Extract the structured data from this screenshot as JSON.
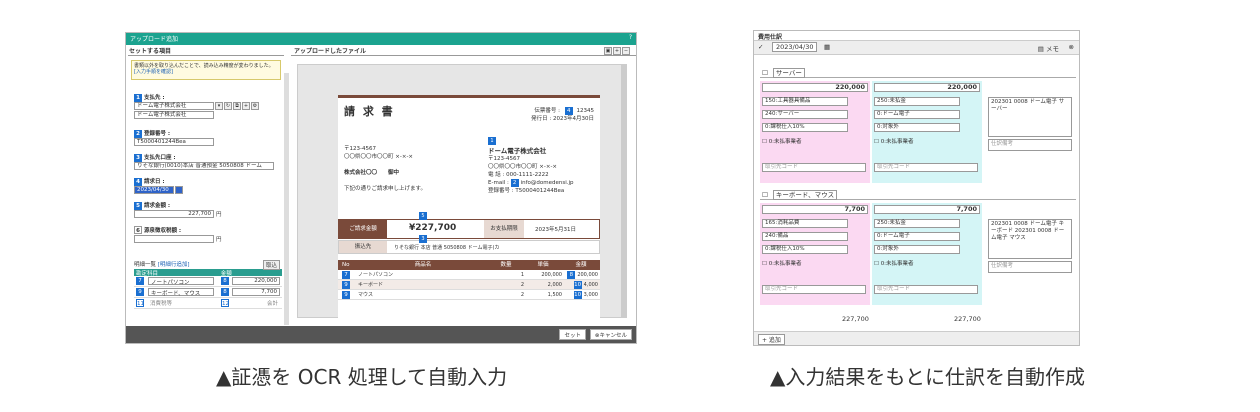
{
  "left": {
    "title": "アップロード追加",
    "left_panel": {
      "section_title": "セットする項目",
      "notice_text": "書類以外を取り込んだことで、読み込み精度が変わりました。",
      "notice_link": "[入力手順を確認]",
      "fields": [
        {
          "num": "1",
          "label": "支払先 :",
          "value": "ドーム電子株式会社",
          "sub": "ドーム電子株式会社"
        },
        {
          "num": "2",
          "label": "登録番号 :",
          "value": "T5000401244Bea"
        },
        {
          "num": "3",
          "label": "支払先口座 :",
          "value": "りそな銀行(0010)本店 普通預金 5050808 ドーム"
        },
        {
          "num": "4",
          "label": "請求日 :",
          "value": "2023/04/30"
        },
        {
          "num": "5",
          "label": "請求金額 :",
          "value": "227,700",
          "unit": "円"
        },
        {
          "num": "6",
          "label": "源泉徴収税額 :",
          "value": "",
          "unit": "円"
        }
      ],
      "detail_label": "明細一覧",
      "detail_link": "[明細行追加]",
      "detail_button": "取込",
      "grid_headers": [
        "勘定科目",
        "金額"
      ],
      "grid_rows": [
        {
          "n1": "7",
          "name": "ノートパソコン",
          "n2": "8",
          "amount": "220,000"
        },
        {
          "n1": "9",
          "name": "キーボード、マウス",
          "n2": "8",
          "amount": "7,700"
        },
        {
          "n1": "11",
          "name": "消費税等",
          "n2": "12",
          "amount": "会計"
        }
      ]
    },
    "right_panel": {
      "section_title": "アップロードしたファイル",
      "invoice": {
        "title": "請 求 書",
        "invoice_no_label": "伝票番号 :",
        "invoice_no": "12345",
        "issue_label": "発行日 :",
        "issue_date": "2023年4月30日",
        "zip": "〒123-4567",
        "address": "〇〇県〇〇市〇〇町 ×-×-×",
        "company_to": "株式会社〇〇",
        "honorific": "御中",
        "greeting": "下記の通りご請求申し上げます。",
        "issuer": "ドーム電子株式会社",
        "issuer_zip": "〒123-4567",
        "issuer_addr": "〇〇県〇〇市〇〇町 ×-×-×",
        "issuer_tel": "000-1111-2222",
        "issuer_mail": "info@domedensi.jp",
        "issuer_reg": "T5000401244Bea",
        "amount_label": "ご請求金額",
        "amount": "¥227,700",
        "due_label": "お支払期限",
        "due_date": "2023年5月31日",
        "bank_label": "振込先",
        "bank_value": "りそな銀行 本店 普通 5050808 ドーム電子(カ",
        "table_headers": [
          "No",
          "商品名",
          "数量",
          "単価",
          "金額"
        ],
        "table_rows": [
          {
            "name": "ノートパソコン",
            "qty": "1",
            "price": "200,000",
            "total": "200,000"
          },
          {
            "name": "キーボード",
            "qty": "2",
            "price": "2,000",
            "total": "4,000"
          },
          {
            "name": "マウス",
            "qty": "2",
            "price": "1,500",
            "total": "3,000"
          }
        ]
      }
    },
    "buttons": {
      "set": "セット",
      "cancel": "キャンセル"
    }
  },
  "right": {
    "title": "費用仕訳",
    "date": "2023/04/30",
    "memo_btn": "メモ",
    "groups": [
      {
        "title": "サーバー",
        "debit_amount": "220,000",
        "credit_amount": "220,000",
        "debit_rows": [
          "150:工具器具備品",
          "240:サーバー",
          "0:課税仕入10%"
        ],
        "credit_rows": [
          "250:未払金",
          "0:ドーム電子",
          "0:対象外"
        ],
        "memo": "202301 0008 ドーム電子 サーバー",
        "sub_memo": "仕訳備考",
        "check1": "0:未払事業者",
        "check2": "0:未払事業者",
        "code1": "取引先コード",
        "code2": "取引先コード"
      },
      {
        "title": "キーボード、マウス",
        "debit_amount": "7,700",
        "credit_amount": "7,700",
        "debit_rows": [
          "165:消耗品費",
          "240:備品",
          "0:課税仕入10%"
        ],
        "credit_rows": [
          "250:未払金",
          "0:ドーム電子",
          "0:対象外"
        ],
        "memo": "202301 0008 ドーム電子 キーボード 202301 0008 ドーム電子 マウス",
        "sub_memo": "仕訳備考",
        "check1": "0:未払事業者",
        "check2": "0:未払事業者",
        "code1": "取引先コード",
        "code2": "取引先コード"
      }
    ],
    "total_debit": "227,700",
    "total_credit": "227,700",
    "add_button": "+ 追加"
  },
  "captions": {
    "left": "▲証憑を OCR 処理して自動入力",
    "right": "▲入力結果をもとに仕訳を自動作成"
  }
}
